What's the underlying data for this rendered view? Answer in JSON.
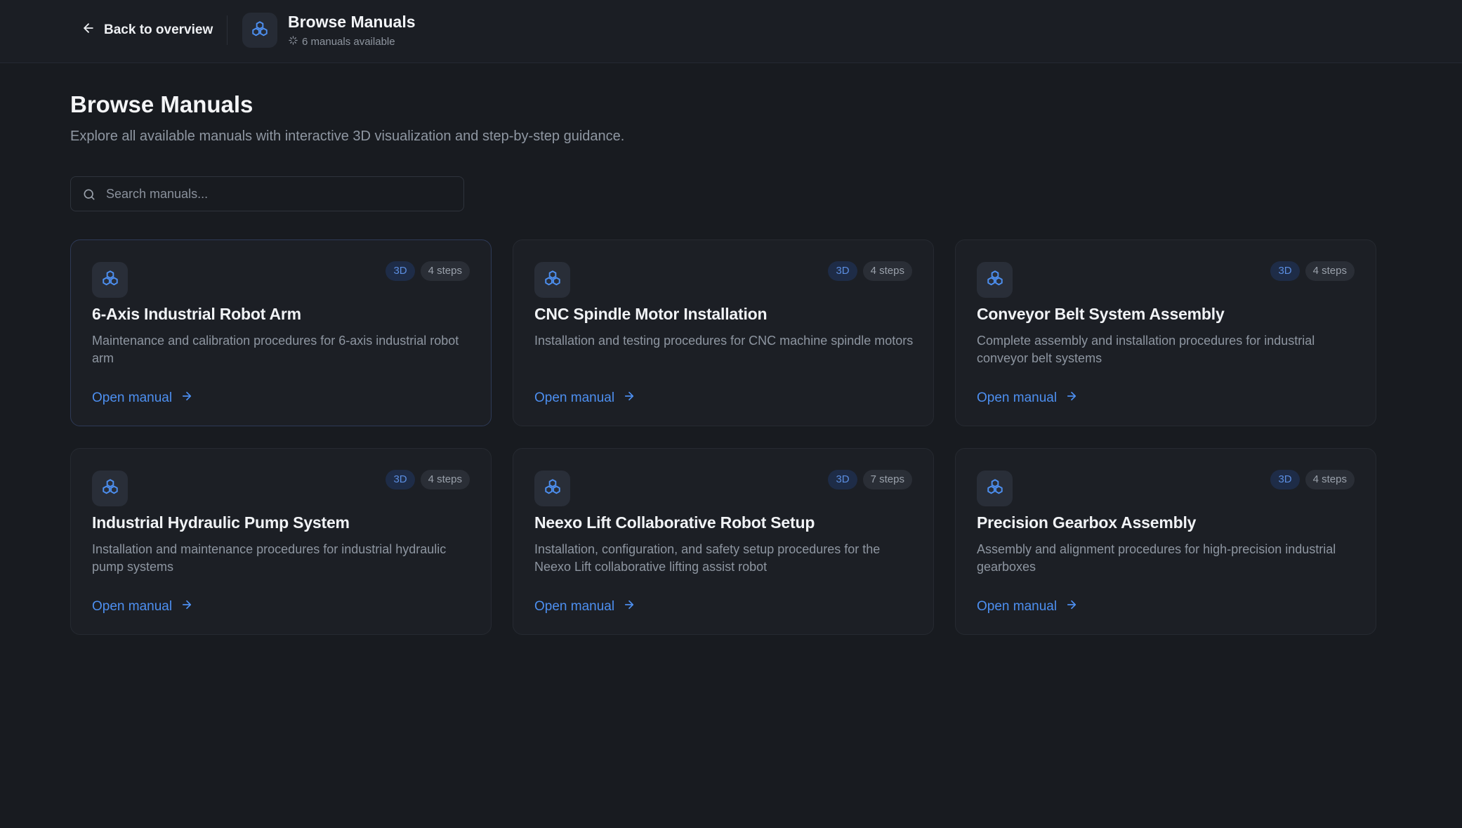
{
  "topbar": {
    "back_label": "Back to overview",
    "title": "Browse Manuals",
    "subtitle": "6 manuals available"
  },
  "page": {
    "title": "Browse Manuals",
    "description": "Explore all available manuals with interactive 3D visualization and step-by-step guidance."
  },
  "search": {
    "placeholder": "Search manuals..."
  },
  "colors": {
    "accent": "#4d8ff0",
    "background": "#181b20",
    "card": "#1c1f25"
  },
  "icons": {
    "back": "arrow-left-icon",
    "app": "cubes-icon",
    "sparkle": "sparkle-icon",
    "search": "search-icon",
    "card": "cubes-icon",
    "link": "arrow-right-icon"
  },
  "manuals": [
    {
      "title": "6-Axis Industrial Robot Arm",
      "description": "Maintenance and calibration procedures for 6-axis industrial robot arm",
      "badge": "3D",
      "steps": "4 steps",
      "link_label": "Open manual"
    },
    {
      "title": "CNC Spindle Motor Installation",
      "description": "Installation and testing procedures for CNC machine spindle motors",
      "badge": "3D",
      "steps": "4 steps",
      "link_label": "Open manual"
    },
    {
      "title": "Conveyor Belt System Assembly",
      "description": "Complete assembly and installation procedures for industrial conveyor belt systems",
      "badge": "3D",
      "steps": "4 steps",
      "link_label": "Open manual"
    },
    {
      "title": "Industrial Hydraulic Pump System",
      "description": "Installation and maintenance procedures for industrial hydraulic pump systems",
      "badge": "3D",
      "steps": "4 steps",
      "link_label": "Open manual"
    },
    {
      "title": "Neexo Lift Collaborative Robot Setup",
      "description": "Installation, configuration, and safety setup procedures for the Neexo Lift collaborative lifting assist robot",
      "badge": "3D",
      "steps": "7 steps",
      "link_label": "Open manual"
    },
    {
      "title": "Precision Gearbox Assembly",
      "description": "Assembly and alignment procedures for high-precision industrial gearboxes",
      "badge": "3D",
      "steps": "4 steps",
      "link_label": "Open manual"
    }
  ]
}
